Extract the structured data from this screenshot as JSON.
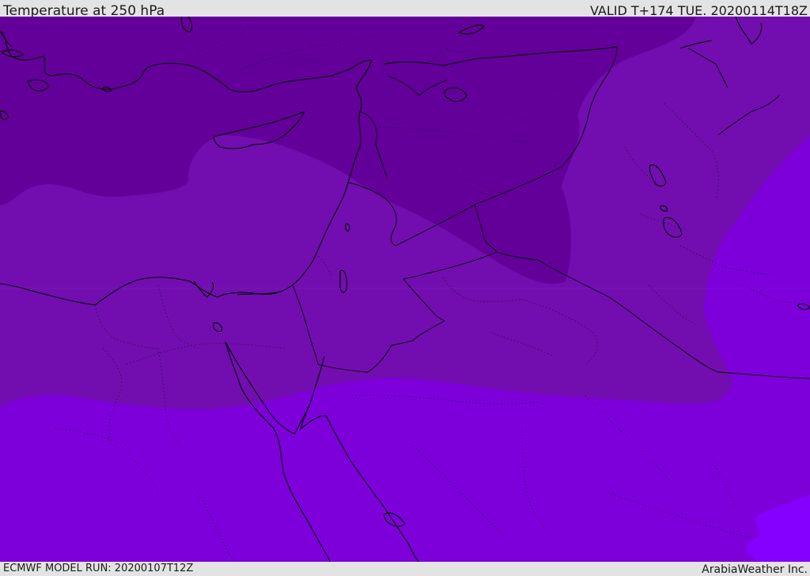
{
  "header": {
    "title": "Temperature at 250 hPa",
    "valid": "VALID T+174 TUE. 20200114T18Z"
  },
  "footer": {
    "model_run": "ECMWF MODEL RUN: 20200107T12Z",
    "brand": "ArabiaWeather Inc."
  },
  "map": {
    "parameter": "Temperature",
    "level": "250 hPa",
    "colors": {
      "band_coldest": "#63009a",
      "band_cold": "#720eaf",
      "band_mid": "#7d00db",
      "band_warm": "#8500ff",
      "coastline": "#000000",
      "borders": "#000000"
    }
  }
}
